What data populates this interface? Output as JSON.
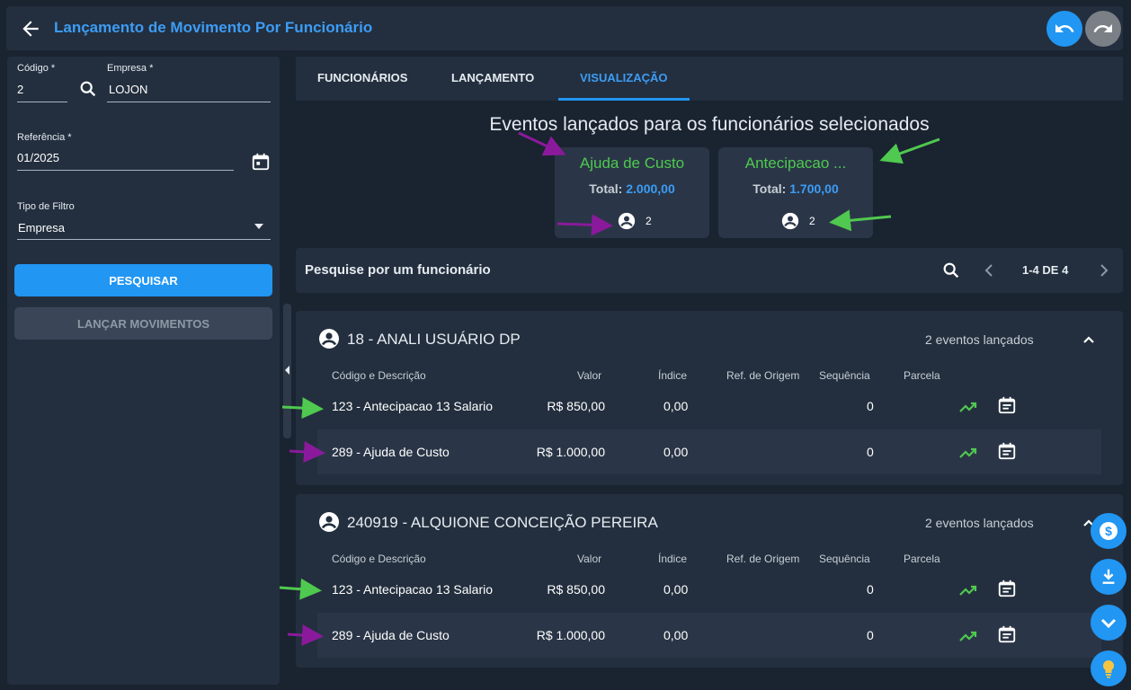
{
  "header": {
    "title": "Lançamento de Movimento Por Funcionário"
  },
  "filters": {
    "codigo_label": "Código *",
    "codigo_value": "2",
    "empresa_label": "Empresa *",
    "empresa_value": "LOJON",
    "referencia_label": "Referência *",
    "referencia_value": "01/2025",
    "tipo_filtro_label": "Tipo de Filtro",
    "tipo_filtro_value": "Empresa",
    "search_button": "PESQUISAR",
    "launch_button": "LANÇAR MOVIMENTOS"
  },
  "tabs": [
    {
      "label": "FUNCIONÁRIOS"
    },
    {
      "label": "LANÇAMENTO"
    },
    {
      "label": "VISUALIZAÇÃO",
      "active": true
    }
  ],
  "events": {
    "title": "Eventos lançados para os funcionários selecionados",
    "total_label": "Total:",
    "cards": [
      {
        "name": "Ajuda de Custo",
        "total": "2.000,00",
        "count": "2"
      },
      {
        "name": "Antecipacao ...",
        "total": "1.700,00",
        "count": "2"
      }
    ]
  },
  "search": {
    "label": "Pesquise por um funcionário",
    "pagination": "1-4 DE 4"
  },
  "columns": [
    "Código e Descrição",
    "Valor",
    "Índice",
    "Ref. de Origem",
    "Sequência",
    "Parcela"
  ],
  "employees": [
    {
      "name": "18 - ANALI USUÁRIO DP",
      "count": "2 eventos lançados",
      "rows": [
        {
          "desc": "123 - Antecipacao 13 Salario",
          "valor": "R$ 850,00",
          "indice": "0,00",
          "sequencia": "0"
        },
        {
          "desc": "289 - Ajuda de Custo",
          "valor": "R$ 1.000,00",
          "indice": "0,00",
          "sequencia": "0"
        }
      ]
    },
    {
      "name": "240919 - ALQUIONE CONCEIÇÃO PEREIRA",
      "count": "2 eventos lançados",
      "rows": [
        {
          "desc": "123 - Antecipacao 13 Salario",
          "valor": "R$ 850,00",
          "indice": "0,00",
          "sequencia": "0"
        },
        {
          "desc": "289 - Ajuda de Custo",
          "valor": "R$ 1.000,00",
          "indice": "0,00",
          "sequencia": "0"
        }
      ]
    }
  ],
  "colors": {
    "accent": "#2196f3",
    "green": "#4fc94f",
    "purple": "#8a1a9b"
  }
}
